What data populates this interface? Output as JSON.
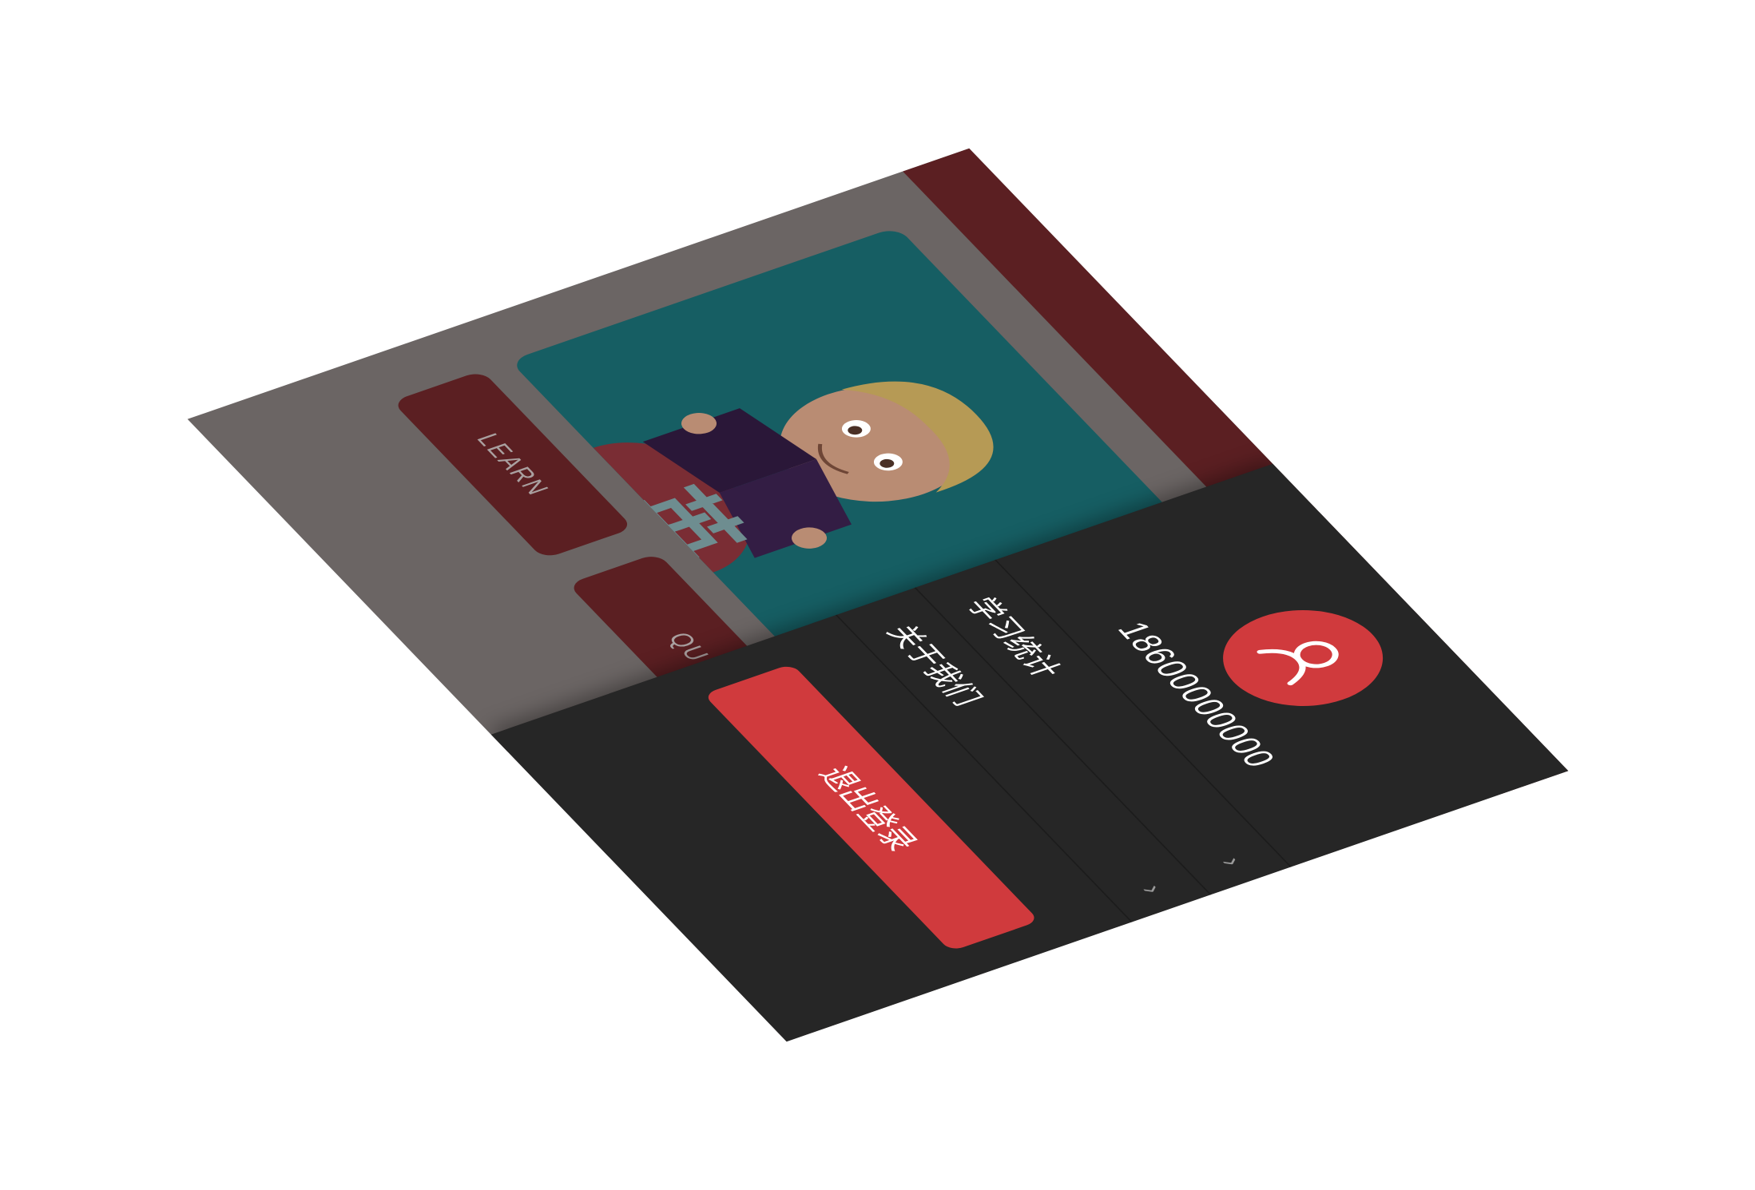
{
  "home": {
    "hero_title": "英",
    "learn_label": "LEARN",
    "quiz_label": "QU"
  },
  "drawer": {
    "phone": "18600000000",
    "menu": [
      {
        "label": "学习统计"
      },
      {
        "label": "关于我们"
      }
    ],
    "logout_label": "退出登录"
  },
  "icons": {
    "avatar": "user-icon",
    "chevron": "chevron-right-icon"
  },
  "colors": {
    "brand_red": "#d03a3d",
    "dark_red": "#5b1f22",
    "drawer_bg": "#262626",
    "hero_teal": "#165e63"
  }
}
